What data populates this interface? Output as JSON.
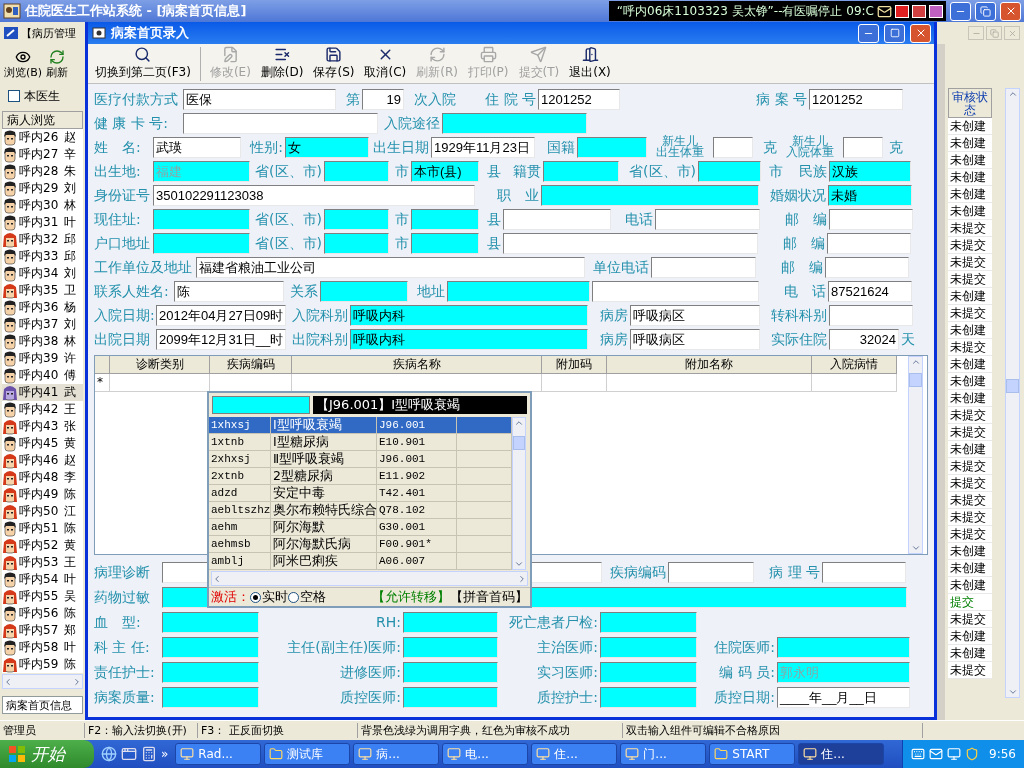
{
  "main_window": {
    "title": "住院医生工作站系统 - [病案首页信息]",
    "ticker": "“呼内06床1103323 吴太铮”--有医嘱停止 09:C"
  },
  "menu": {
    "label": "【病历管理"
  },
  "main_toolbar": [
    {
      "label": "浏览(B)",
      "kind": "browse"
    },
    {
      "label": "刷新",
      "kind": "refresh"
    }
  ],
  "doctor_filter": {
    "label": "本医生",
    "checked": false
  },
  "patient_list": {
    "header": "病人浏览",
    "patients": [
      {
        "label": "呼内26",
        "name": "赵",
        "kind": "male",
        "selected": false
      },
      {
        "label": "呼内27",
        "name": "辛",
        "kind": "male",
        "selected": false
      },
      {
        "label": "呼内28",
        "name": "朱",
        "kind": "male",
        "selected": false
      },
      {
        "label": "呼内29",
        "name": "刘",
        "kind": "male",
        "selected": false
      },
      {
        "label": "呼内30",
        "name": "林",
        "kind": "male",
        "selected": false
      },
      {
        "label": "呼内31",
        "name": "叶",
        "kind": "male",
        "selected": false
      },
      {
        "label": "呼内32",
        "name": "邱",
        "kind": "female",
        "selected": false
      },
      {
        "label": "呼内33",
        "name": "邱",
        "kind": "male",
        "selected": false
      },
      {
        "label": "呼内34",
        "name": "刘",
        "kind": "male",
        "selected": false
      },
      {
        "label": "呼内35",
        "name": "卫",
        "kind": "female",
        "selected": false
      },
      {
        "label": "呼内36",
        "name": "杨",
        "kind": "male",
        "selected": false
      },
      {
        "label": "呼内37",
        "name": "刘",
        "kind": "male",
        "selected": false
      },
      {
        "label": "呼内38",
        "name": "林",
        "kind": "male",
        "selected": false
      },
      {
        "label": "呼内39",
        "name": "许",
        "kind": "male",
        "selected": false
      },
      {
        "label": "呼内40",
        "name": "傅",
        "kind": "male",
        "selected": false
      },
      {
        "label": "呼内41",
        "name": "武",
        "kind": "female",
        "selected": true
      },
      {
        "label": "呼内42",
        "name": "王",
        "kind": "male",
        "selected": false
      },
      {
        "label": "呼内43",
        "name": "张",
        "kind": "female",
        "selected": false
      },
      {
        "label": "呼内45",
        "name": "黄",
        "kind": "male",
        "selected": false
      },
      {
        "label": "呼内46",
        "name": "赵",
        "kind": "female",
        "selected": false
      },
      {
        "label": "呼内48",
        "name": "李",
        "kind": "female",
        "selected": false
      },
      {
        "label": "呼内49",
        "name": "陈",
        "kind": "female",
        "selected": false
      },
      {
        "label": "呼内50",
        "name": "江",
        "kind": "female",
        "selected": false
      },
      {
        "label": "呼内51",
        "name": "陈",
        "kind": "male",
        "selected": false
      },
      {
        "label": "呼内52",
        "name": "黄",
        "kind": "female",
        "selected": false
      },
      {
        "label": "呼内53",
        "name": "王",
        "kind": "female",
        "selected": false
      },
      {
        "label": "呼内54",
        "name": "叶",
        "kind": "male",
        "selected": false
      },
      {
        "label": "呼内55",
        "name": "吴",
        "kind": "female",
        "selected": false
      },
      {
        "label": "呼内56",
        "name": "陈",
        "kind": "male",
        "selected": false
      },
      {
        "label": "呼内57",
        "name": "郑",
        "kind": "female",
        "selected": false
      },
      {
        "label": "呼内58",
        "name": "叶",
        "kind": "male",
        "selected": false
      },
      {
        "label": "呼内59",
        "name": "陈",
        "kind": "female",
        "selected": false
      }
    ]
  },
  "review_status": {
    "header": "审核状态",
    "rows": [
      {
        "text": "未创建",
        "kind": "pending"
      },
      {
        "text": "未创建",
        "kind": "pending"
      },
      {
        "text": "未创建",
        "kind": "pending"
      },
      {
        "text": "未创建",
        "kind": "pending"
      },
      {
        "text": "未创建",
        "kind": "pending"
      },
      {
        "text": "未创建",
        "kind": "pending"
      },
      {
        "text": "未提交",
        "kind": "pending"
      },
      {
        "text": "未提交",
        "kind": "pending"
      },
      {
        "text": "未提交",
        "kind": "pending"
      },
      {
        "text": "未提交",
        "kind": "pending"
      },
      {
        "text": "未创建",
        "kind": "pending"
      },
      {
        "text": "未提交",
        "kind": "pending"
      },
      {
        "text": "未创建",
        "kind": "pending"
      },
      {
        "text": "未提交",
        "kind": "pending"
      },
      {
        "text": "未创建",
        "kind": "pending"
      },
      {
        "text": "未创建",
        "kind": "pending"
      },
      {
        "text": "未创建",
        "kind": "pending"
      },
      {
        "text": "未提交",
        "kind": "pending"
      },
      {
        "text": "未提交",
        "kind": "pending"
      },
      {
        "text": "未创建",
        "kind": "pending"
      },
      {
        "text": "未提交",
        "kind": "pending"
      },
      {
        "text": "未提交",
        "kind": "pending"
      },
      {
        "text": "未提交",
        "kind": "pending"
      },
      {
        "text": "未提交",
        "kind": "pending"
      },
      {
        "text": "未提交",
        "kind": "pending"
      },
      {
        "text": "未创建",
        "kind": "pending"
      },
      {
        "text": "未创建",
        "kind": "pending"
      },
      {
        "text": "未创建",
        "kind": "pending"
      },
      {
        "text": "提交",
        "kind": "submitted"
      },
      {
        "text": "未提交",
        "kind": "pending"
      },
      {
        "text": "未创建",
        "kind": "pending"
      },
      {
        "text": "未创建",
        "kind": "pending"
      },
      {
        "text": "未提交",
        "kind": "pending"
      }
    ]
  },
  "left_tab": "病案首页信息",
  "status_bar": {
    "user": "管理员",
    "hints": [
      "F2：输入法切换(开)",
      "F3：  正反面切换",
      "背景色浅绿为调用字典，红色为审核不成功",
      "双击输入组件可编辑不合格原因"
    ]
  },
  "dialog": {
    "title": "病案首页录入",
    "toolbar": [
      {
        "label": "切换到第二页(F3)",
        "kind": "search",
        "disabled": false
      },
      {
        "label": "修改(E)",
        "kind": "edit",
        "disabled": true
      },
      {
        "label": "删除(D)",
        "kind": "delete",
        "disabled": false
      },
      {
        "label": "保存(S)",
        "kind": "save",
        "disabled": false
      },
      {
        "label": "取消(C)",
        "kind": "cancel",
        "disabled": false
      },
      {
        "label": "刷新(R)",
        "kind": "refresh",
        "disabled": true
      },
      {
        "label": "打印(P)",
        "kind": "print",
        "disabled": true
      },
      {
        "label": "提交(T)",
        "kind": "submit",
        "disabled": true
      },
      {
        "label": "退出(X)",
        "kind": "exit",
        "disabled": false
      }
    ],
    "upper_rows": [
      {
        "items": [
          {
            "kind": "label",
            "text": "医疗付款方式"
          },
          {
            "kind": "field",
            "value": "医保",
            "dict": false
          },
          {
            "kind": "label",
            "text": "第"
          },
          {
            "kind": "field",
            "value": "19",
            "dict": false
          },
          {
            "kind": "label",
            "text": "次入院"
          },
          {
            "kind": "label",
            "text": "住 院 号"
          },
          {
            "kind": "field",
            "value": "1201252",
            "dict": false
          },
          {
            "kind": "label",
            "text": "病 案 号"
          },
          {
            "kind": "field",
            "value": "1201252",
            "dict": false
          }
        ]
      },
      {
        "items": [
          {
            "kind": "label",
            "text": "健 康 卡 号:"
          },
          {
            "kind": "field",
            "dict": false
          },
          {
            "kind": "label",
            "text": "入院途径"
          },
          {
            "kind": "field",
            "dict": true
          }
        ]
      },
      {
        "items": [
          {
            "kind": "label",
            "text": "姓　名:"
          },
          {
            "kind": "field",
            "value": "武瑛",
            "dict": false
          },
          {
            "kind": "label",
            "text": "性别:"
          },
          {
            "kind": "field",
            "value": "女",
            "dict": true
          },
          {
            "kind": "label",
            "text": "出生日期"
          },
          {
            "kind": "field",
            "value": "1929年11月23日",
            "dict": false
          },
          {
            "kind": "label",
            "text": "国籍"
          },
          {
            "kind": "field",
            "dict": true
          },
          {
            "kind": "stacked_label",
            "lines": [
              "新生儿",
              "出生体重"
            ]
          },
          {
            "kind": "field",
            "dict": false
          },
          {
            "kind": "label",
            "text": "克"
          },
          {
            "kind": "stacked_label",
            "lines": [
              "新生儿",
              "入院体重"
            ]
          },
          {
            "kind": "field",
            "dict": false
          },
          {
            "kind": "label",
            "text": "克"
          }
        ]
      },
      {
        "items": [
          {
            "kind": "label",
            "text": "出生地:"
          },
          {
            "kind": "field",
            "value": "福建",
            "dict": true,
            "greyed": true
          },
          {
            "kind": "label",
            "text": "省(区、市)"
          },
          {
            "kind": "field",
            "dict": true
          },
          {
            "kind": "label",
            "text": "市"
          },
          {
            "kind": "field",
            "value": "本市(县)",
            "dict": true
          },
          {
            "kind": "label",
            "text": "县"
          },
          {
            "kind": "label",
            "text": "籍贯"
          },
          {
            "kind": "field",
            "dict": true
          },
          {
            "kind": "label",
            "text": "省(区、市)"
          },
          {
            "kind": "field",
            "dict": true
          },
          {
            "kind": "label",
            "text": "市"
          },
          {
            "kind": "label",
            "text": "民族"
          },
          {
            "kind": "field",
            "value": "汉族",
            "dict": true
          }
        ]
      },
      {
        "items": [
          {
            "kind": "label",
            "text": "身份证号"
          },
          {
            "kind": "field",
            "value": "350102291123038",
            "dict": false
          },
          {
            "kind": "label",
            "text": "职　业"
          },
          {
            "kind": "field",
            "dict": true
          },
          {
            "kind": "label",
            "text": "婚姻状况"
          },
          {
            "kind": "field",
            "value": "未婚",
            "dict": true
          }
        ]
      },
      {
        "items": [
          {
            "kind": "label",
            "text": "现住址:"
          },
          {
            "kind": "field",
            "dict": true
          },
          {
            "kind": "label",
            "text": "省(区、市)"
          },
          {
            "kind": "field",
            "dict": true
          },
          {
            "kind": "label",
            "text": "市"
          },
          {
            "kind": "field",
            "dict": true
          },
          {
            "kind": "label",
            "text": "县"
          },
          {
            "kind": "field",
            "dict": false
          },
          {
            "kind": "label",
            "text": "电话"
          },
          {
            "kind": "field",
            "dict": false
          },
          {
            "kind": "label",
            "text": "邮　编"
          },
          {
            "kind": "field",
            "dict": false
          }
        ]
      },
      {
        "items": [
          {
            "kind": "label",
            "text": "户口地址"
          },
          {
            "kind": "field",
            "dict": true
          },
          {
            "kind": "label",
            "text": "省(区、市)"
          },
          {
            "kind": "field",
            "dict": true
          },
          {
            "kind": "label",
            "text": "市"
          },
          {
            "kind": "field",
            "dict": true
          },
          {
            "kind": "label",
            "text": "县"
          },
          {
            "kind": "field",
            "dict": false
          },
          {
            "kind": "label",
            "text": "邮　编"
          },
          {
            "kind": "field",
            "dict": false
          }
        ]
      },
      {
        "items": [
          {
            "kind": "label",
            "text": "工作单位及地址"
          },
          {
            "kind": "field",
            "value": "福建省粮油工业公司",
            "dict": false
          },
          {
            "kind": "label",
            "text": "单位电话"
          },
          {
            "kind": "field",
            "dict": false
          },
          {
            "kind": "label",
            "text": "邮　编"
          },
          {
            "kind": "field",
            "dict": false
          }
        ]
      },
      {
        "items": [
          {
            "kind": "label",
            "text": "联系人姓名:"
          },
          {
            "kind": "field",
            "value": "陈",
            "dict": false
          },
          {
            "kind": "label",
            "text": "关系"
          },
          {
            "kind": "field",
            "dict": true
          },
          {
            "kind": "label",
            "text": "地址"
          },
          {
            "kind": "field",
            "dict": true
          },
          {
            "kind": "field",
            "dict": false
          },
          {
            "kind": "label",
            "text": "电　话"
          },
          {
            "kind": "field",
            "value": "87521624",
            "dict": false
          }
        ]
      },
      {
        "items": [
          {
            "kind": "label",
            "text": "入院日期:"
          },
          {
            "kind": "field",
            "value": "2012年04月27日09时",
            "dict": false
          },
          {
            "kind": "label",
            "text": "入院科别"
          },
          {
            "kind": "field",
            "value": "呼吸内科",
            "dict": true
          },
          {
            "kind": "label",
            "text": "病房"
          },
          {
            "kind": "field",
            "value": "呼吸病区",
            "dict": false
          },
          {
            "kind": "label",
            "text": "转科科别"
          },
          {
            "kind": "field",
            "dict": false
          }
        ]
      },
      {
        "items": [
          {
            "kind": "label",
            "text": "出院日期"
          },
          {
            "kind": "field",
            "value": "2099年12月31日__时",
            "dict": false
          },
          {
            "kind": "label",
            "text": "出院科别"
          },
          {
            "kind": "field",
            "value": "呼吸内科",
            "dict": true
          },
          {
            "kind": "label",
            "text": "病房"
          },
          {
            "kind": "field",
            "value": "呼吸病区",
            "dict": false
          },
          {
            "kind": "label",
            "text": "实际住院"
          },
          {
            "kind": "field",
            "value": "32024",
            "dict": false
          },
          {
            "kind": "label",
            "text": "天"
          }
        ]
      }
    ],
    "diagnosis_table": {
      "columns": [
        "诊断类别",
        "疾病编码",
        "疾病名称",
        "附加码",
        "附加名称",
        "入院病情"
      ],
      "new_row_marker": "*"
    },
    "code_lookup": {
      "preview": "【J96.001】Ⅰ型呼吸衰竭",
      "rows": [
        {
          "code": "1xhxsj",
          "name": "Ⅰ型呼吸衰竭",
          "icd": "J96.001",
          "selected": true
        },
        {
          "code": "1xtnb",
          "name": "Ⅰ型糖尿病",
          "icd": "E10.901",
          "selected": false
        },
        {
          "code": "2xhxsj",
          "name": "Ⅱ型呼吸衰竭",
          "icd": "J96.001",
          "selected": false
        },
        {
          "code": "2xtnb",
          "name": "2型糖尿病",
          "icd": "E11.902",
          "selected": false
        },
        {
          "code": "adzd",
          "name": "安定中毒",
          "icd": "T42.401",
          "selected": false
        },
        {
          "code": "aebltszhz",
          "name": "奥尔布赖特氏综合",
          "icd": "Q78.102",
          "selected": false
        },
        {
          "code": "aehm",
          "name": "阿尔海默",
          "icd": "G30.001",
          "selected": false
        },
        {
          "code": "aehmsb",
          "name": "阿尔海默氏病",
          "icd": "F00.901*",
          "selected": false
        },
        {
          "code": "amblj",
          "name": "阿米巴痢疾",
          "icd": "A06.007",
          "selected": false
        }
      ],
      "activate_label": "激活：",
      "modes": [
        {
          "label": "实时",
          "selected": true
        },
        {
          "label": "空格",
          "selected": false
        }
      ],
      "transfer": "【允许转移】",
      "method": "【拼音首码】"
    },
    "lower_rows": [
      {
        "items": [
          {
            "kind": "label",
            "text": "病理诊断"
          },
          {
            "kind": "field",
            "dict": false
          },
          {
            "kind": "label",
            "text": "疾病编码"
          },
          {
            "kind": "field",
            "dict": false
          },
          {
            "kind": "label",
            "text": "病 理 号"
          },
          {
            "kind": "field",
            "dict": false
          }
        ]
      },
      {
        "items": [
          {
            "kind": "label",
            "text": "药物过敏"
          },
          {
            "kind": "field",
            "dict": true
          }
        ]
      },
      {
        "items": [
          {
            "kind": "label",
            "text": "血　型:"
          },
          {
            "kind": "field",
            "dict": true
          },
          {
            "kind": "label",
            "text": "RH:"
          },
          {
            "kind": "field",
            "dict": true
          },
          {
            "kind": "label",
            "text": "死亡患者尸检:"
          },
          {
            "kind": "field",
            "dict": true
          }
        ]
      },
      {
        "items": [
          {
            "kind": "label",
            "text": "科 主 任:"
          },
          {
            "kind": "field",
            "dict": true
          },
          {
            "kind": "label",
            "text": "主任(副主任)医师:"
          },
          {
            "kind": "field",
            "dict": true
          },
          {
            "kind": "label",
            "text": "主治医师:"
          },
          {
            "kind": "field",
            "dict": true
          },
          {
            "kind": "label",
            "text": "住院医师:"
          },
          {
            "kind": "field",
            "dict": true
          }
        ]
      },
      {
        "items": [
          {
            "kind": "label",
            "text": "责任护士:"
          },
          {
            "kind": "field",
            "dict": true
          },
          {
            "kind": "label",
            "text": "进修医师:"
          },
          {
            "kind": "field",
            "dict": true
          },
          {
            "kind": "label",
            "text": "实习医师:"
          },
          {
            "kind": "field",
            "dict": true
          },
          {
            "kind": "label",
            "text": "编 码 员:"
          },
          {
            "kind": "field",
            "value": "郭永明",
            "dict": true,
            "greyed": true
          }
        ]
      },
      {
        "items": [
          {
            "kind": "label",
            "text": "病案质量:"
          },
          {
            "kind": "field",
            "dict": true
          },
          {
            "kind": "label",
            "text": "质控医师:"
          },
          {
            "kind": "field",
            "dict": true
          },
          {
            "kind": "label",
            "text": "质控护士:"
          },
          {
            "kind": "field",
            "dict": true
          },
          {
            "kind": "label",
            "text": "质控日期:"
          },
          {
            "kind": "field",
            "value": "____年__月__日",
            "dict": false
          }
        ]
      }
    ]
  },
  "taskbar": {
    "start": "开始",
    "more": "»",
    "tasks": [
      {
        "label": "Rad...",
        "kind": "app",
        "active": false
      },
      {
        "label": "测试库",
        "kind": "folder",
        "active": false
      },
      {
        "label": "病...",
        "kind": "app",
        "active": false
      },
      {
        "label": "电...",
        "kind": "app",
        "active": false
      },
      {
        "label": "住...",
        "kind": "app",
        "active": false
      },
      {
        "label": "门...",
        "kind": "app",
        "active": false
      },
      {
        "label": "START",
        "kind": "folder",
        "active": false
      },
      {
        "label": "住...",
        "kind": "app",
        "active": true
      }
    ],
    "clock": "9:56"
  }
}
